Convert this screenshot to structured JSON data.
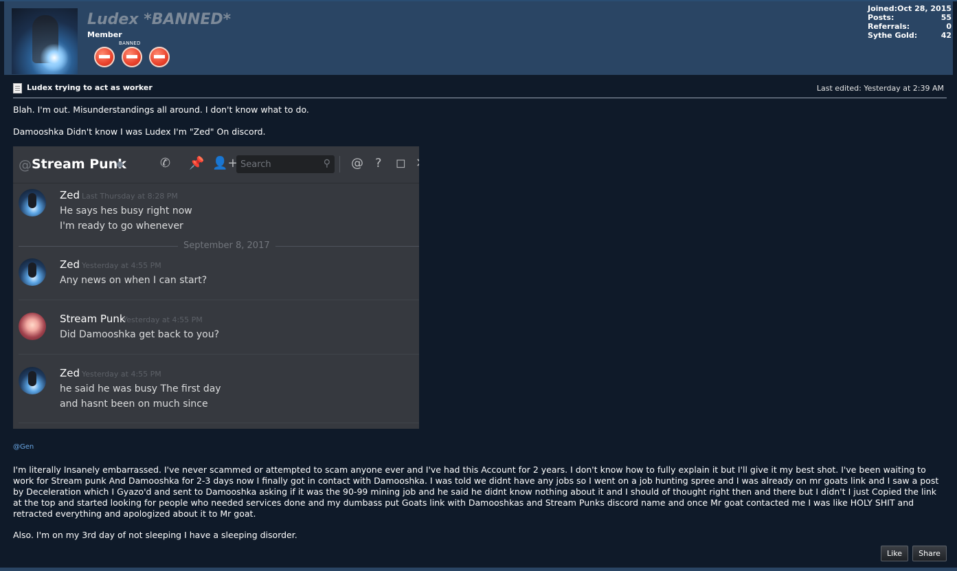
{
  "profile": {
    "username": "Ludex *BANNED*",
    "user_title": "Member",
    "banned_caption": "BANNED",
    "stats": [
      {
        "label": "Joined:",
        "value": "Oct 28, 2015"
      },
      {
        "label": "Posts:",
        "value": "55"
      },
      {
        "label": "Referrals:",
        "value": "0"
      },
      {
        "label": "Sythe Gold:",
        "value": "42"
      }
    ]
  },
  "post": {
    "title": "Ludex trying to act as worker",
    "last_edited": "Last edited: Yesterday at 2:39 AM",
    "line1": "Blah. I'm out. Misunderstandings all around. I don't know what to do.",
    "line2": "Damooshka Didn't know I was Ludex I'm \"Zed\" On discord.",
    "mention": "@Gen",
    "body": "I'm literally Insanely embarrassed. I've never scammed or attempted to scam anyone ever and I've had this Account for 2 years. I don't know how to fully explain it but I'll give it my best shot. I've been waiting to work for Stream punk And Damooshka for 2-3 days now I finally got in contact with Damooshka. I was told we didnt have any jobs so I went on a job hunting spree and I was already on mr goats link and I saw a post by Deceleration which I Gyazo'd and sent to Damooshka asking if it was the 90-99 mining job and he said he didnt know nothing about it and I should of thought right then and there but I didn't I just Copied the link at the top and started looking for people who needed services done and my dumbass put Goats link with Damooshkas and Stream Punks discord name and once Mr goat contacted me I was like HOLY SHIT and retracted everything and apologized about it to Mr goat.",
    "footer_line": "Also. I'm on my 3rd day of not sleeping I have a sleeping disorder.",
    "like_label": "Like",
    "share_label": "Share"
  },
  "discord": {
    "at": "@",
    "channel": "Stream Punk",
    "search_placeholder": "Search",
    "date_divider": "September 8, 2017",
    "messages": [
      {
        "author": "Zed",
        "time": "Last Thursday at 8:28 PM",
        "lines": [
          "He says hes busy right now",
          "I'm ready to go whenever"
        ]
      },
      {
        "author": "Zed",
        "time": "Yesterday at 4:55 PM",
        "lines": [
          "Any news on when I can start?"
        ]
      },
      {
        "author": "Stream Punk",
        "time": "Yesterday at 4:55 PM",
        "lines": [
          "Did Damooshka get back to you?"
        ]
      },
      {
        "author": "Zed",
        "time": "Yesterday at 4:55 PM",
        "lines": [
          "he said he was busy The first day",
          "and hasnt been on much since"
        ]
      }
    ]
  }
}
